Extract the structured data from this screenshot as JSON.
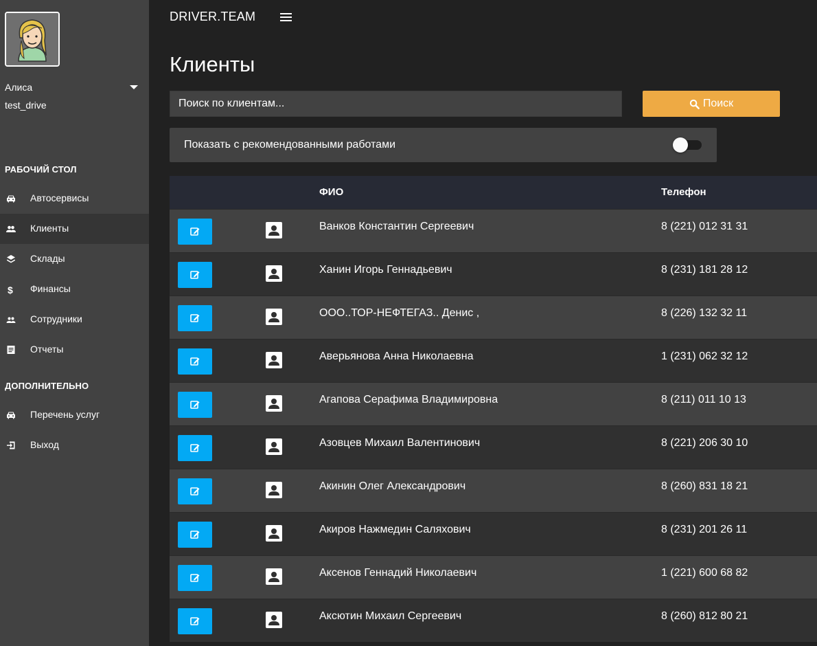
{
  "app": {
    "brand": "DRIVER.TEAM"
  },
  "user": {
    "name": "Алиса",
    "login": "test_drive"
  },
  "sidebar": {
    "section_main": "РАБОЧИЙ СТОЛ",
    "section_extra": "ДОПОЛНИТЕЛЬНО",
    "items": [
      {
        "label": "Автосервисы",
        "icon": "car-icon"
      },
      {
        "label": "Клиенты",
        "icon": "people-icon"
      },
      {
        "label": "Склады",
        "icon": "layers-icon"
      },
      {
        "label": "Финансы",
        "icon": "dollar-icon"
      },
      {
        "label": "Сотрудники",
        "icon": "people-icon"
      },
      {
        "label": "Отчеты",
        "icon": "report-icon"
      }
    ],
    "extra_items": [
      {
        "label": "Перечень услуг",
        "icon": "car-icon"
      },
      {
        "label": "Выход",
        "icon": "logout-icon"
      }
    ]
  },
  "page": {
    "title": "Клиенты"
  },
  "search": {
    "placeholder": "Поиск по клиентам...",
    "value": "",
    "button_label": "Поиск"
  },
  "filter": {
    "label": "Показать с рекомендованными работами",
    "enabled": false
  },
  "table": {
    "columns": [
      "",
      "",
      "ФИО",
      "Телефон"
    ],
    "rows": [
      {
        "name": "Ванков Константин Сергеевич",
        "phone": "8 (221) 012 31 31"
      },
      {
        "name": "Ханин Игорь Геннадьевич",
        "phone": "8 (231) 181 28 12"
      },
      {
        "name": "ООО..ТОР-НЕФТЕГАЗ.. Денис ,",
        "phone": "8 (226) 132 32 11"
      },
      {
        "name": "Аверьянова Анна Николаевна",
        "phone": "1 (231) 062 32 12"
      },
      {
        "name": "Агапова Серафима Владимировна",
        "phone": "8 (211) 011 10 13"
      },
      {
        "name": "Азовцев Михаил Валентинович",
        "phone": "8 (221) 206 30 10"
      },
      {
        "name": "Акинин Олег Александрович",
        "phone": "8 (260) 831 18 21"
      },
      {
        "name": "Акиров Нажмедин Саляхович",
        "phone": "8 (231) 201 26 11"
      },
      {
        "name": "Аксенов Геннадий Николаевич",
        "phone": "1 (221) 600 68 82"
      },
      {
        "name": "Аксютин Михаил Сергеевич",
        "phone": "8 (260) 812 80 21"
      }
    ]
  },
  "colors": {
    "sidebar_bg": "#424242",
    "page_bg": "#212121",
    "accent_blue": "#03a9f4",
    "accent_orange": "#eeaa44",
    "table_header_bg": "#272a35"
  }
}
